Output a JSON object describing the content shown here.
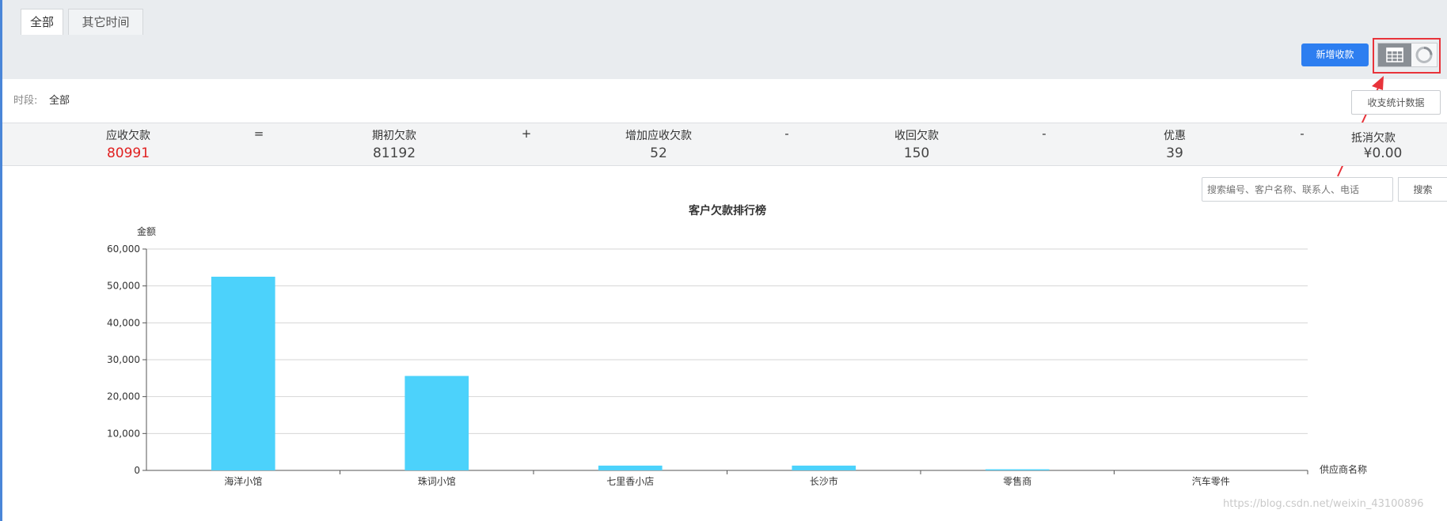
{
  "tabs": [
    "全部",
    "其它时间"
  ],
  "toolbar": {
    "add_label": "新增收款",
    "view_table_icon": "table-icon",
    "view_chart_icon": "donut-icon"
  },
  "period": {
    "label": "时段:",
    "value": "全部"
  },
  "stats_button": "收支统计数据",
  "summary": {
    "items": [
      {
        "label": "应收欠款",
        "value": "80991",
        "color": "#e02020"
      },
      {
        "label": "期初欠款",
        "value": "81192"
      },
      {
        "label": "增加应收欠款",
        "value": "52"
      },
      {
        "label": "收回欠款",
        "value": "150"
      },
      {
        "label": "优惠",
        "value": "39"
      },
      {
        "label": "抵消欠款",
        "value": "¥0.00"
      }
    ],
    "operators": [
      "=",
      "+",
      "-",
      "-",
      "-"
    ]
  },
  "search": {
    "placeholder": "搜索编号、客户名称、联系人、电话",
    "button": "搜索"
  },
  "chart_data": {
    "type": "bar",
    "title": "客户欠款排行榜",
    "ylabel": "金额",
    "xlabel": "供应商名称",
    "categories": [
      "海洋小馆",
      "珠词小馆",
      "七里香小店",
      "长沙市",
      "零售商",
      "汽车零件"
    ],
    "values": [
      52500,
      25600,
      1300,
      1300,
      300,
      0
    ],
    "ylim": [
      0,
      60000
    ],
    "yticks": [
      "0",
      "10,000",
      "20,000",
      "30,000",
      "40,000",
      "50,000",
      "60,000"
    ],
    "bar_color": "#4cd2fb",
    "grid": true
  },
  "watermark": "https://blog.csdn.net/weixin_43100896"
}
